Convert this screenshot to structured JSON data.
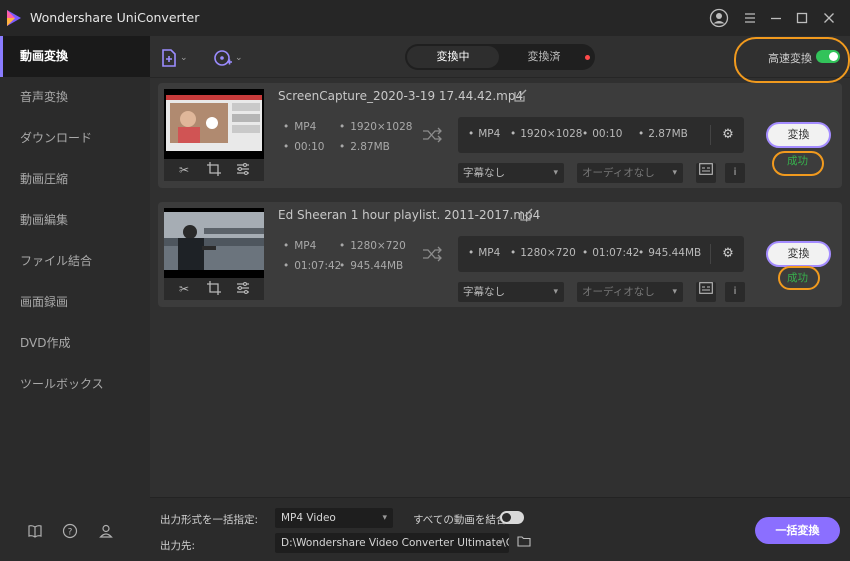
{
  "app": {
    "title": "Wondershare UniConverter",
    "brand_color": "#8a7cff",
    "accent_color": "#f19a1e"
  },
  "titlebar": {
    "icons": [
      "user-icon",
      "menu-icon",
      "minimize-icon",
      "maximize-icon",
      "close-icon"
    ]
  },
  "sidebar": {
    "items": [
      {
        "label": "動画変換",
        "active": true
      },
      {
        "label": "音声変換",
        "active": false
      },
      {
        "label": "ダウンロード",
        "active": false
      },
      {
        "label": "動画圧縮",
        "active": false
      },
      {
        "label": "動画編集",
        "active": false
      },
      {
        "label": "ファイル結合",
        "active": false
      },
      {
        "label": "画面録画",
        "active": false
      },
      {
        "label": "DVD作成",
        "active": false
      },
      {
        "label": "ツールボックス",
        "active": false
      }
    ],
    "bottom_icons": [
      "guide-book-icon",
      "help-icon",
      "account-icon"
    ]
  },
  "toolbar": {
    "add_file_icon": "add-file-icon",
    "add_disc_icon": "add-disc-icon",
    "tabs": [
      {
        "label": "変換中",
        "active": true
      },
      {
        "label": "変換済",
        "active": false,
        "dot": true
      }
    ],
    "high_speed_label": "高速変換",
    "high_speed_on": true,
    "toggle_color": "#32c35a"
  },
  "files": [
    {
      "name": "ScreenCapture_2020-3-19 17.44.42.mp4",
      "source": {
        "format": "MP4",
        "resolution": "1920×1028",
        "duration": "00:10",
        "size": "2.87MB"
      },
      "target": {
        "format": "MP4",
        "resolution": "1920×1028",
        "duration": "00:10",
        "size": "2.87MB"
      },
      "subtitle": "字幕なし",
      "audio": "オーディオなし",
      "convert_label": "変換",
      "status": "成功"
    },
    {
      "name": "Ed Sheeran 1 hour playlist. 2011-2017.mp4",
      "source": {
        "format": "MP4",
        "resolution": "1280×720",
        "duration": "01:07:42",
        "size": "945.44MB"
      },
      "target": {
        "format": "MP4",
        "resolution": "1280×720",
        "duration": "01:07:42",
        "size": "945.44MB"
      },
      "subtitle": "字幕なし",
      "audio": "オーディオなし",
      "convert_label": "変換",
      "status": "成功"
    }
  ],
  "bottom": {
    "output_format_label": "出力形式を一括指定:",
    "output_format_value": "MP4 Video",
    "merge_label": "すべての動画を結合",
    "merge_on": false,
    "output_dest_label": "出力先:",
    "output_dest_value": "D:\\Wondershare Video Converter Ultimate\\Co",
    "batch_convert_label": "一括変換"
  }
}
